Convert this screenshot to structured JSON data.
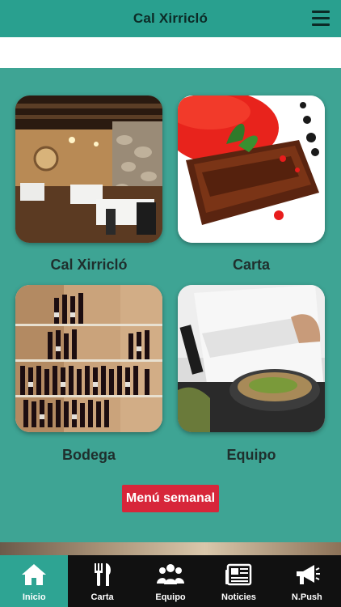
{
  "header": {
    "title": "Cal Xirricló",
    "menu_icon": "hamburger-menu-icon"
  },
  "tiles": [
    {
      "label": "Cal Xirricló",
      "image": "restaurant-dining-room"
    },
    {
      "label": "Carta",
      "image": "plated-dish"
    },
    {
      "label": "Bodega",
      "image": "wine-shelf"
    },
    {
      "label": "Equipo",
      "image": "chef-cooking"
    }
  ],
  "cta": {
    "label": "Menú semanal"
  },
  "tabbar": {
    "items": [
      {
        "label": "Inicio",
        "icon": "home-icon",
        "active": true
      },
      {
        "label": "Carta",
        "icon": "cutlery-icon",
        "active": false
      },
      {
        "label": "Equipo",
        "icon": "group-icon",
        "active": false
      },
      {
        "label": "Noticies",
        "icon": "newspaper-icon",
        "active": false
      },
      {
        "label": "N.Push",
        "icon": "megaphone-icon",
        "active": false
      }
    ]
  },
  "colors": {
    "header": "#29a08f",
    "background": "#3ea494",
    "cta": "#d7263a",
    "tabbar": "#111111",
    "tab_active": "#2ea493"
  }
}
